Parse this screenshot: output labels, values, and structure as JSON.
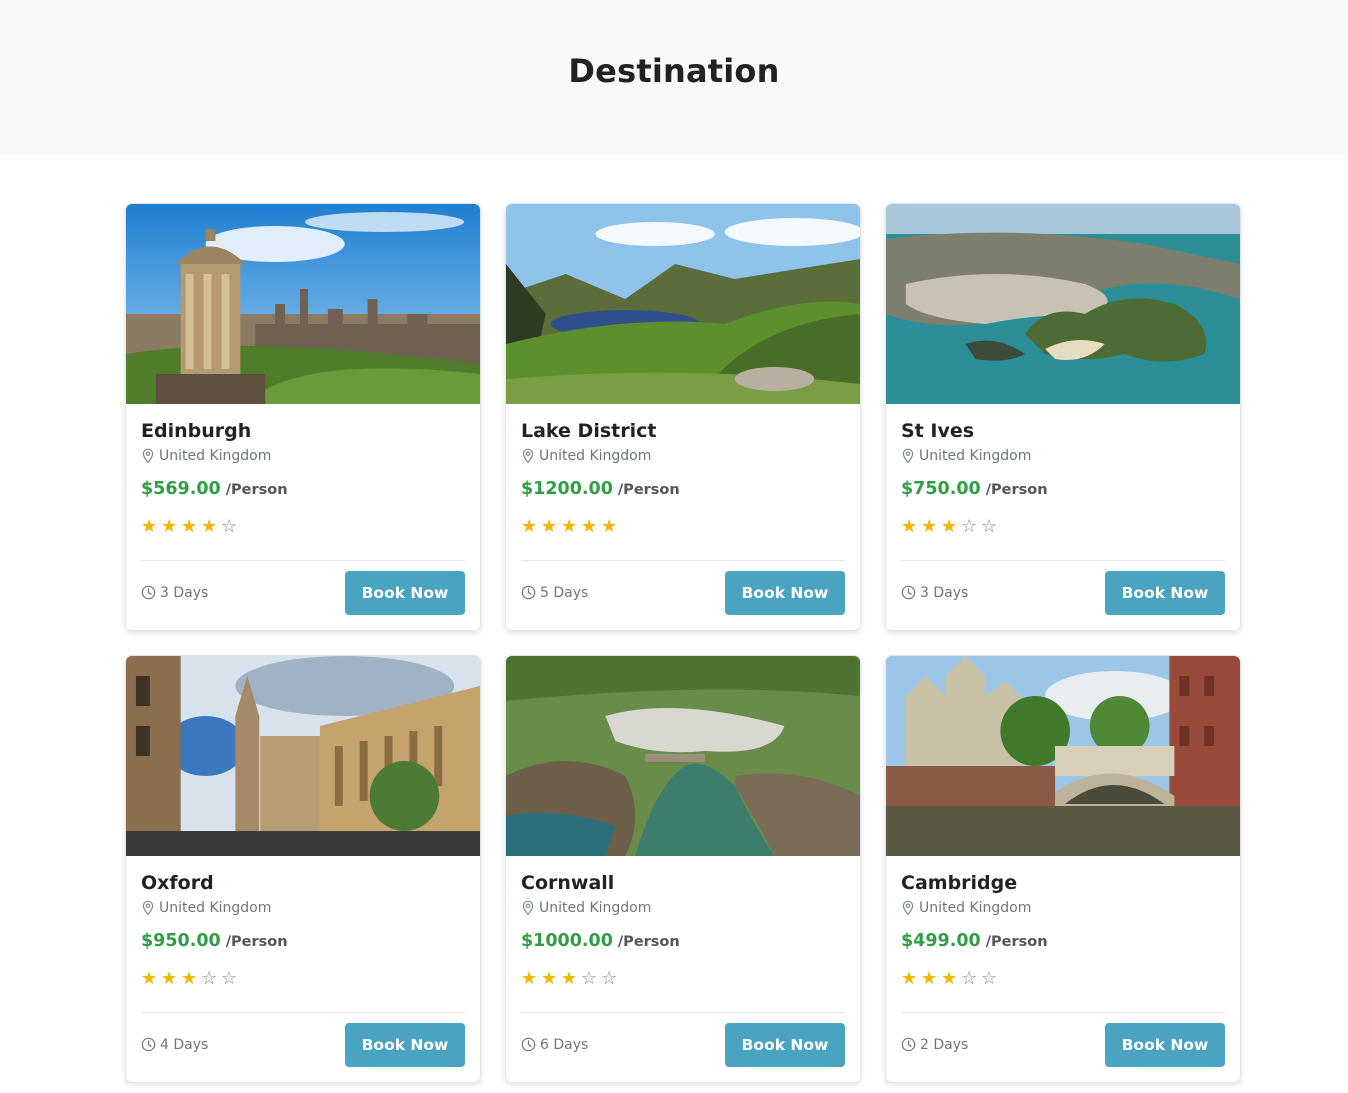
{
  "page": {
    "title": "Destination"
  },
  "colors": {
    "accent": "#4aa3c0",
    "price": "#2f9e44",
    "star": "#f5b400",
    "hero_bg": "#f8f9fa"
  },
  "destinations": [
    {
      "name": "Edinburgh",
      "country": "United Kingdom",
      "price": "$569.00",
      "per": "/Person",
      "rating": 4,
      "rating_max": 5,
      "duration": "3 Days",
      "button": "Book Now",
      "scene": "city-skyline"
    },
    {
      "name": "Lake District",
      "country": "United Kingdom",
      "price": "$1200.00",
      "per": "/Person",
      "rating": 5,
      "rating_max": 5,
      "duration": "5 Days",
      "button": "Book Now",
      "scene": "mountain-lake"
    },
    {
      "name": "St Ives",
      "country": "United Kingdom",
      "price": "$750.00",
      "per": "/Person",
      "rating": 3,
      "rating_max": 5,
      "duration": "3 Days",
      "button": "Book Now",
      "scene": "coast-aerial"
    },
    {
      "name": "Oxford",
      "country": "United Kingdom",
      "price": "$950.00",
      "per": "/Person",
      "rating": 3,
      "rating_max": 5,
      "duration": "4 Days",
      "button": "Book Now",
      "scene": "gothic-street"
    },
    {
      "name": "Cornwall",
      "country": "United Kingdom",
      "price": "$1000.00",
      "per": "/Person",
      "rating": 3,
      "rating_max": 5,
      "duration": "6 Days",
      "button": "Book Now",
      "scene": "harbour-cove"
    },
    {
      "name": "Cambridge",
      "country": "United Kingdom",
      "price": "$499.00",
      "per": "/Person",
      "rating": 3,
      "rating_max": 5,
      "duration": "2 Days",
      "button": "Book Now",
      "scene": "river-bridge"
    }
  ]
}
